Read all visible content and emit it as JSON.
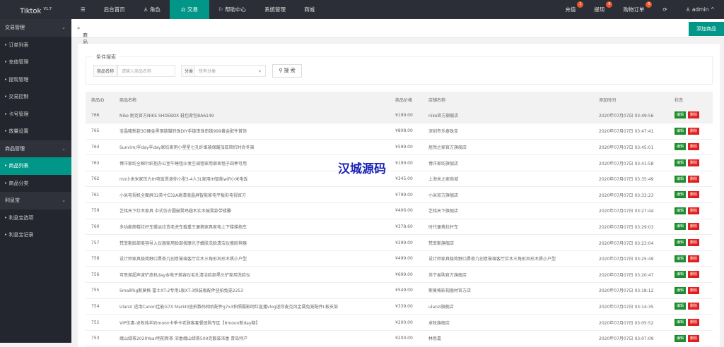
{
  "app": {
    "title": "Tiktok",
    "version": "V1.7"
  },
  "nav": {
    "menu_icon": "☰",
    "items": [
      "后台首页",
      "角色",
      "交易",
      "帮助中心",
      "系统管理",
      "商城"
    ],
    "active": "交易"
  },
  "topright": {
    "recharge": "充值",
    "recharge_count": "1",
    "withdraw": "提现",
    "withdraw_count": "0",
    "orders": "购物订单",
    "orders_count": "0",
    "user": "admin"
  },
  "sidebar": {
    "groups": [
      {
        "label": "交易管理",
        "items": [
          "订单列表",
          "充值管理",
          "提现管理",
          "交易控制",
          "卡号管理",
          "放量设置"
        ]
      },
      {
        "label": "商品管理",
        "items": [
          "商品列表",
          "商品分类"
        ]
      },
      {
        "label": "利息宝",
        "items": [
          "利息宝选项",
          "利息宝记录"
        ]
      }
    ],
    "active": "商品列表"
  },
  "breadcrumb": "商品管理",
  "add_button": "添加商品",
  "search": {
    "legend": "条件搜索",
    "name_label": "商品名称",
    "name_placeholder": "请输入商品名称",
    "cat_label": "分类",
    "cat_value": "所有分类",
    "button": "搜 索"
  },
  "table": {
    "headers": [
      "商品ID",
      "商品名称",
      "商品价格",
      "店铺名称",
      "添加时间",
      "状态"
    ],
    "edit": "编辑",
    "delete": "删除",
    "rows": [
      [
        "766",
        "Nike 耐克官方NIKE SHOEBOX 鞋包背包BA6149",
        "¥199.00",
        "nike官方旗舰店",
        "2020年07月07日 03:49:56"
      ],
      [
        "765",
        "宝晶隆新款3D硬金黑钢链猫转珠DIY手链串珠串链999黄金配件首饰",
        "¥808.00",
        "深圳市乐泰珠宝",
        "2020年07月07日 03:47:41"
      ],
      [
        "764",
        "Sunvim/孚day孚day家纺家用小星星七孔纤维被保暖加厚简约时尚冬被",
        "¥599.00",
        "居然之家官方旗舰店",
        "2020年07月07日 03:45:01"
      ],
      [
        "763",
        "博洋家纺全棉针织抱办公室午睡毯沙发空调毯家用宿舍毯子四季可用",
        "¥199.00",
        "博洋家纺旗舰店",
        "2020年07月07日 03:41:58"
      ],
      [
        "762",
        "mi/小米米家压力IH电饭煲迷你小型3-4人3L家用IH智能wifi小米电饭",
        "¥345.00",
        "上海米之家商城",
        "2020年07月07日 03:35:49"
      ],
      [
        "761",
        "小米电视机全面屏32英寸E32A高清液晶屏智能家电平板彩电视官方",
        "¥799.00",
        "小米官方旗舰店",
        "2020年07月07日 03:33:23"
      ],
      [
        "759",
        "艺铭天下红木家具 中式仿古圆鼓凳鸡翅木实木鼓凳款带镂雕",
        "¥406.00",
        "艺铭天下旗舰店",
        "2020年07月07日 03:27:44"
      ],
      [
        "760",
        "多功能爬楼拉杆车搬运拉货老虎车载重王便携家具家电上下楼梯拖车",
        "¥378.60",
        "时代便携拉杆车",
        "2020年07月07日 03:29:03"
      ],
      [
        "757",
        "梵菲斯脸部美容导入仪器家用脸部按摩光子嫩肤洗脸清洁仪瘦脸神器",
        "¥299.00",
        "梵菲斯旗舰店",
        "2020年07月07日 03:23:04"
      ],
      [
        "758",
        "设计师家具极简野口勇茶几创意玻璃客厅实木三角形异形木质小户型",
        "¥499.00",
        "设计师家具极简野口勇茶几创意玻璃客厅实木三角形异形木质小户型",
        "2020年07月07日 03:25:49"
      ],
      [
        "756",
        "可思美超声波铲皮机day本电子美容仪毛孔清洁脸部黑头铲家用洗脸仪",
        "¥699.00",
        "苏宁易购官方旗舰店",
        "2020年07月07日 03:20:47"
      ],
      [
        "755",
        "SmallRig斯莫格 富士XT-2专用L板XT-3快装板配件竖拍兔笼2253",
        "¥549.00",
        "斯莫格影视器材官方店",
        "2020年07月07日 03:18:12"
      ],
      [
        "754",
        "Ulanzi 适用Canon佳能G7X MarkIII竖拍数码相机配件g7x3拍照摄影网红直播vlog迷你麦克风金属兔笼配件L板支架",
        "¥339.00",
        "ulanzi旗舰店",
        "2020年07月07日 03:14:35"
      ],
      [
        "752",
        "VIP优惠-卓牧纯羊奶moon卡季卡老顾客套餐团购专区【6moon新day期】",
        "¥200.00",
        "卓牧旗舰店",
        "2020年07月07日 03:05:52"
      ],
      [
        "753",
        "峨山绿茶2020Year明前新茶 浓香峨山绿茶500克散装浓香 青岛特产",
        "¥200.00",
        "林思嘉",
        "2020年07月07日 03:07:09"
      ]
    ]
  },
  "watermark": "汉城源码"
}
